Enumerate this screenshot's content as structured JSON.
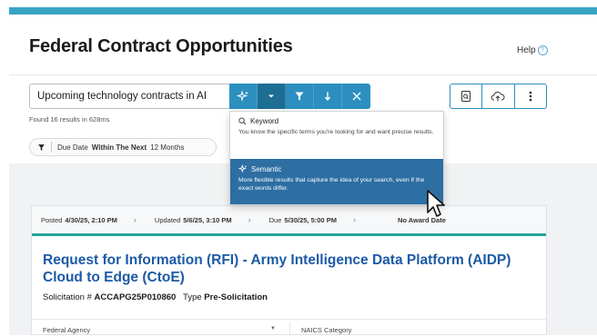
{
  "header": {
    "title": "Federal Contract Opportunities",
    "help_label": "Help"
  },
  "search": {
    "query": "Upcoming technology contracts in AI",
    "results_text": "Found 16 results in 628ms",
    "buttons": [
      "semantic-search-icon",
      "chevron-down-icon",
      "filter-icon",
      "sort-icon",
      "close-icon"
    ]
  },
  "actions": [
    "saved-search-icon",
    "cloud-upload-icon",
    "more-options-icon"
  ],
  "filter_chip": {
    "field": "Due Date",
    "operator": "Within The Next",
    "value": "12 Months"
  },
  "search_mode_menu": {
    "options": [
      {
        "label": "Keyword",
        "description": "You know the specific terms you're looking for and want precise results.",
        "icon": "search-icon",
        "selected": false
      },
      {
        "label": "Semantic",
        "description": "More flexible results that capture the idea of your search, even if the exact words differ.",
        "icon": "sparkle-icon",
        "selected": true
      }
    ]
  },
  "result": {
    "posted_label": "Posted",
    "posted": "4/30/25, 2:10 PM",
    "updated_label": "Updated",
    "updated": "5/6/25, 3:10 PM",
    "due_label": "Due",
    "due": "5/30/25, 5:00 PM",
    "award": "No Award Date",
    "title": "Request for Information (RFI) - Army Intelligence Data Platform (AIDP) Cloud to Edge (CtoE)",
    "solicitation_label": "Solicitation #",
    "solicitation_number": "ACCAPG25P010860",
    "type_label": "Type",
    "type": "Pre-Solicitation",
    "agency_label": "Federal Agency",
    "naics_label": "NAICS Category"
  },
  "colors": {
    "accent": "#2c8fbf",
    "selected_option": "#2d6ea3",
    "title_link": "#1c5aa6",
    "top_bar": "#3aa4c4",
    "card_rule": "#22a39a"
  }
}
